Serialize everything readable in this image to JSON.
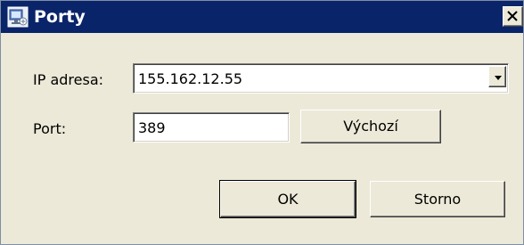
{
  "window": {
    "title": "Porty",
    "close_label": "x"
  },
  "ip_address": {
    "label": "IP adresa:",
    "value": "155.162.12.55"
  },
  "port": {
    "label": "Port:",
    "value": "389",
    "default_button_label": "Výchozí"
  },
  "actions": {
    "ok_label": "OK",
    "cancel_label": "Storno"
  },
  "colors": {
    "titlebar": "#0a246a",
    "dialog_background": "#ece9d8"
  }
}
